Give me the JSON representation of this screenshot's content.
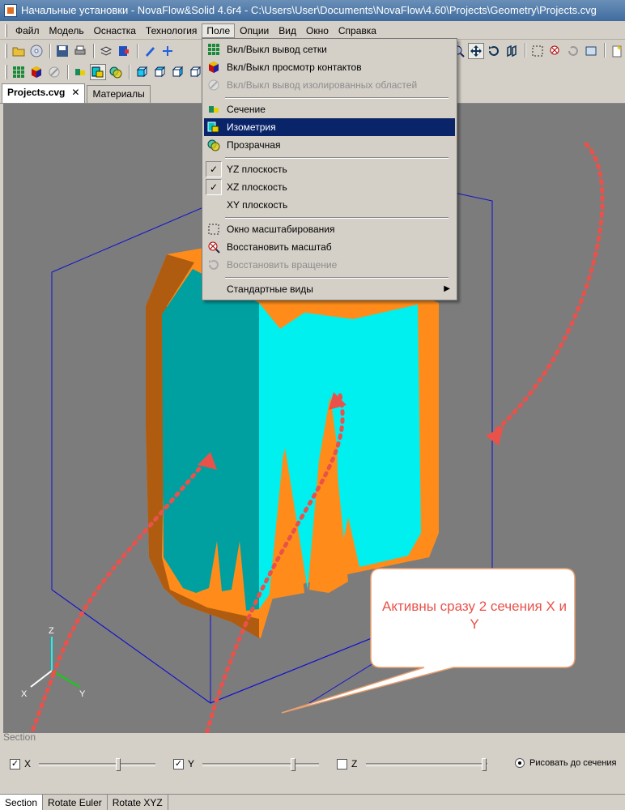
{
  "window": {
    "title": "Начальные установки - NovaFlow&Solid 4.6r4 - C:\\Users\\User\\Documents\\NovaFlow\\4.60\\Projects\\Geometry\\Projects.cvg"
  },
  "menubar": {
    "items": [
      {
        "label": "Файл"
      },
      {
        "label": "Модель"
      },
      {
        "label": "Оснастка"
      },
      {
        "label": "Технология"
      },
      {
        "label": "Поле",
        "active": true
      },
      {
        "label": "Опции"
      },
      {
        "label": "Вид"
      },
      {
        "label": "Окно"
      },
      {
        "label": "Справка"
      }
    ]
  },
  "tabs": [
    {
      "label": "Projects.cvg",
      "close": "✕",
      "active": true
    },
    {
      "label": "Материалы",
      "active": false
    }
  ],
  "field_menu": {
    "items": [
      {
        "label": "Вкл/Выкл вывод сетки",
        "icon": "grid-icon",
        "enabled": true
      },
      {
        "label": "Вкл/Выкл просмотр контактов",
        "icon": "cube-contacts-icon",
        "enabled": true
      },
      {
        "label": "Вкл/Выкл вывод изолированных областей",
        "icon": "isolated-areas-icon",
        "enabled": false
      },
      {
        "label": "Сечение",
        "icon": "section-icon",
        "enabled": true
      },
      {
        "label": "Изометрия",
        "icon": "isometry-icon",
        "enabled": true,
        "highlighted": true
      },
      {
        "label": "Прозрачная",
        "icon": "transparent-icon",
        "enabled": true
      },
      {
        "label": "YZ плоскость",
        "checked": true
      },
      {
        "label": "XZ плоскость",
        "checked": true
      },
      {
        "label": "XY плоскость",
        "checked": false
      },
      {
        "label": "Окно масштабирования",
        "icon": "zoom-window-icon",
        "enabled": true
      },
      {
        "label": "Восстановить масштаб",
        "icon": "restore-zoom-icon",
        "enabled": true
      },
      {
        "label": "Восстановить вращение",
        "icon": "restore-rotation-icon",
        "enabled": false
      },
      {
        "label": "Стандартные виды",
        "submenu": true,
        "arrow": "▶"
      }
    ]
  },
  "viewport": {
    "axes": {
      "z": "Z",
      "x": "X",
      "y": "Y"
    },
    "callout_text": "Активны сразу 2 сечения X и Y",
    "colors": {
      "background": "#7c7c7c",
      "cyan": "#00f0f0",
      "teal": "#00a0a0",
      "orange": "#ff8c1a",
      "dark_orange": "#b05c10",
      "bounding_box": "#1010d0",
      "annotation": "#e8524a"
    }
  },
  "section_panel": {
    "title": "Section",
    "x": {
      "label": "X",
      "checked": true,
      "checkmark": "✓",
      "position": 0.68
    },
    "y": {
      "label": "Y",
      "checked": true,
      "checkmark": "✓",
      "position": 0.78
    },
    "z": {
      "label": "Z",
      "checked": false,
      "position": 1.0
    },
    "draw_until_section": {
      "label": "Рисовать до сечения",
      "selected": true
    }
  },
  "bottom_tabs": [
    {
      "label": "Section",
      "active": true
    },
    {
      "label": "Rotate Euler",
      "active": false
    },
    {
      "label": "Rotate XYZ",
      "active": false
    }
  ]
}
